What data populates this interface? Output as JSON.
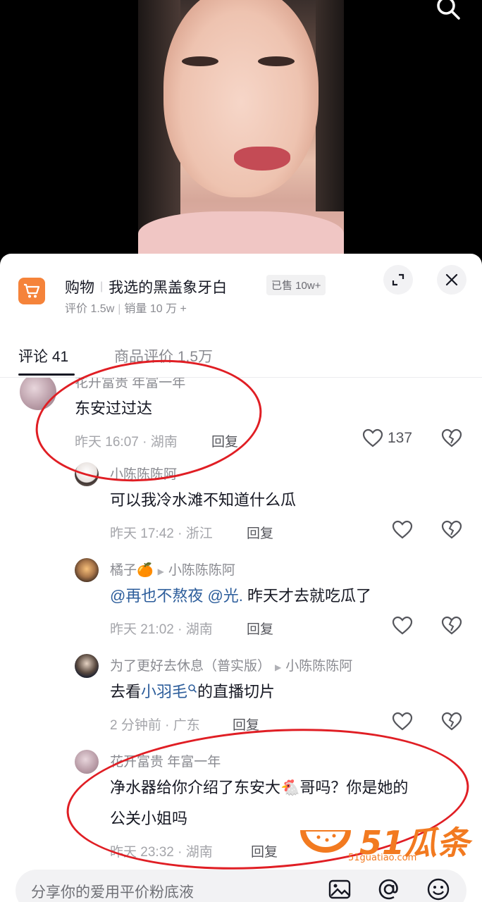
{
  "product": {
    "category": "购物",
    "name": "我选的黑盖象牙白",
    "sold": "已售 10w+",
    "rating_label": "评价 1.5w",
    "sales_label": "销量 10 万 +"
  },
  "tabs": [
    {
      "label": "评论 41"
    },
    {
      "label": "商品评价 1.5万"
    }
  ],
  "comments": [
    {
      "name": "花开富贵 年富一年",
      "text": "东安过过达",
      "time": "昨天 16:07 · 湖南",
      "reply": "回复",
      "likes": "137"
    },
    {
      "name": "小陈陈陈阿",
      "text": "可以我冷水滩不知道什么瓜",
      "time": "昨天 17:42 · 浙江",
      "reply": "回复"
    },
    {
      "name": "橘子🍊",
      "reply_to": "小陈陈陈阿",
      "mention1": "@再也不熬夜",
      "mention2": "@光.",
      "text_after": "昨天才去就吃瓜了",
      "time": "昨天 21:02 · 湖南",
      "reply": "回复"
    },
    {
      "name": "为了更好去休息（普实版）",
      "reply_to": "小陈陈陈阿",
      "text_before": "去看",
      "text_link": "小羽毛",
      "text_after": "的直播切片",
      "time": "2 分钟前 · 广东",
      "reply": "回复"
    },
    {
      "name": "花开富贵 年富一年",
      "text_line1": "净水器给你介绍了东安大🐔哥吗？你是她的",
      "text_line2": "公关小姐吗",
      "time": "昨天 23:32 · 湖南",
      "reply": "回复"
    }
  ],
  "input": {
    "placeholder": "分享你的爱用平价粉底液"
  },
  "watermark": {
    "brand": "51瓜条",
    "url": "51guatiao.com"
  }
}
